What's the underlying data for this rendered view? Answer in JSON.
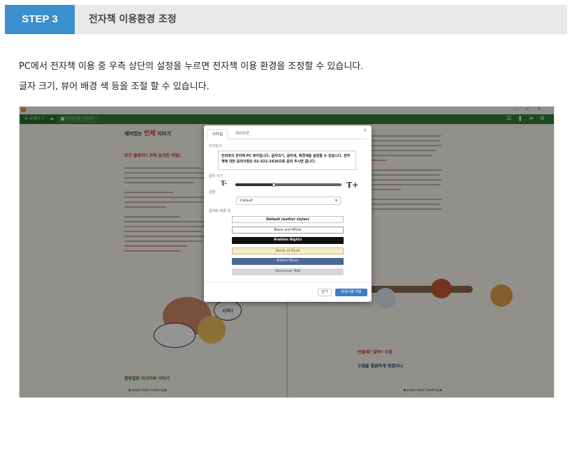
{
  "step": {
    "badge": "STEP 3",
    "title": "전자책 이용환경 조정"
  },
  "description": {
    "line1": "PC에서 전자책 이용 중 우측 상단의 설정을 누르면 전자책 이용 환경을 조정할 수 있습니다.",
    "line2": "글자 크기, 뷰어 배경 색 등을 조절 할 수 있습니다."
  },
  "toolbar": {
    "library_label": "내 서재가기",
    "search_placeholder": "검색어를 입력하세요"
  },
  "book": {
    "left_header_prefix": "재미있는",
    "left_header_highlight": "인체",
    "left_header_suffix": "이야기",
    "left_section": "요건 몰랐지? 코에 숨겨진 비밀!",
    "left_bottom": "찰랑찰랑 머리카락 이야기",
    "right_section": "민들레? 말야? 수염",
    "right_sub": "수염을 깔끔하게 깎았더니",
    "pager_left": "page data loading",
    "pager_right": "page data loading",
    "speech_bubble": "사파!"
  },
  "dialog": {
    "tab_style": "스타일",
    "tab_layout": "레이아웃",
    "close": "×",
    "preview_label": "미리보기",
    "preview_text": "인터파크 전자책 PC 뷰어입니다. 글자크기, 글자색, 배경색을 설정할 수 있습니다. 전자책에 대한 문의사항은 02-322-2426으로 문의 주시면 됩니다.",
    "font_size_label": "글자 크기",
    "font_size_small": "T-",
    "font_size_large": "T+",
    "font_label": "글꼴",
    "font_value": "Default",
    "theme_label": "글자와 배경 색",
    "themes": [
      "Default (author styles)",
      "Black and White",
      "Arabian Nights",
      "Sands of Dune",
      "Ballard Blues",
      "Vancouver Mist"
    ],
    "close_button": "닫기",
    "save_button": "변경사항 저장"
  },
  "slider": {
    "value_fraction": 0.36
  },
  "colors": {
    "badge": "#3a8fcc",
    "toolbar": "#2f7f3a",
    "save": "#3b7cc9"
  }
}
